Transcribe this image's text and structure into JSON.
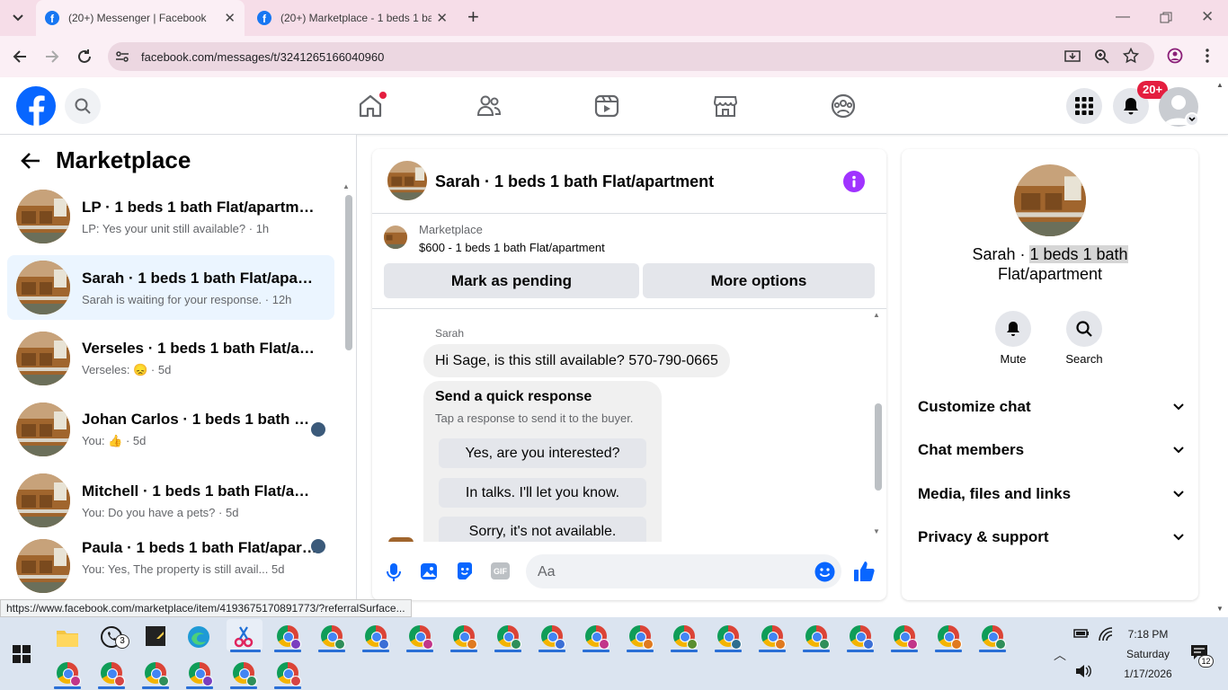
{
  "browser": {
    "tabs": [
      {
        "title": "(20+) Messenger | Facebook",
        "active": true
      },
      {
        "title": "(20+) Marketplace - 1 beds 1 ba",
        "active": false
      }
    ],
    "new_tab_symbol": "+",
    "url": "facebook.com/messages/t/3241265166040960"
  },
  "fb_header": {
    "notification_badge": "20+",
    "nav_icons": [
      "home-icon",
      "friends-icon",
      "watch-icon",
      "marketplace-icon",
      "groups-icon"
    ]
  },
  "left_panel": {
    "title": "Marketplace",
    "conversations": [
      {
        "name": "LP · 1 beds 1 bath Flat/apartment",
        "snippet": "LP: Yes your unit still available?",
        "time": "· 1h",
        "selected": false,
        "emoji": "",
        "avatar": false
      },
      {
        "name": "Sarah · 1 beds 1 bath Flat/apartment",
        "snippet": "Sarah is waiting for your response.",
        "time": "· 12h",
        "selected": true,
        "emoji": "",
        "avatar": false
      },
      {
        "name": "Verseles · 1 beds 1 bath Flat/apartment",
        "snippet": "Verseles: ",
        "time": "· 5d",
        "selected": false,
        "emoji": "😞",
        "avatar": false
      },
      {
        "name": "Johan Carlos · 1 beds 1 bath Flat/apartment",
        "snippet": "You: ",
        "time": "· 5d",
        "selected": false,
        "emoji": "👍",
        "avatar": true
      },
      {
        "name": "Mitchell · 1 beds 1 bath Flat/apartment",
        "snippet": "You: Do you have a pets?",
        "time": "· 5d",
        "selected": false,
        "emoji": "",
        "avatar": false
      },
      {
        "name": "Paula · 1 beds 1 bath Flat/apartment",
        "snippet": "You: Yes, The property is still avail...",
        "time": "5d",
        "selected": false,
        "emoji": "",
        "avatar": true
      }
    ]
  },
  "chat": {
    "title": "Sarah · 1 beds 1 bath Flat/apartment",
    "listing_label": "Marketplace",
    "listing_price_title": "$600 - 1 beds 1 bath Flat/apartment",
    "mark_pending": "Mark as pending",
    "more_options": "More options",
    "sender": "Sarah",
    "message": "Hi Sage, is this still available? 570-790-0665",
    "quick_title": "Send a quick response",
    "quick_sub": "Tap a response to send it to the buyer.",
    "quick_replies": [
      "Yes, are you interested?",
      "In talks. I'll let you know.",
      "Sorry, it's not available."
    ],
    "input_placeholder": "Aa",
    "gif_label": "GIF"
  },
  "info_panel": {
    "name_prefix": "Sarah · ",
    "name_highlight": "1 beds 1 bath",
    "name_line2": "Flat/apartment",
    "mute_label": "Mute",
    "search_label": "Search",
    "sections": [
      "Customize chat",
      "Chat members",
      "Media, files and links",
      "Privacy & support"
    ]
  },
  "status_url": "https://www.facebook.com/marketplace/item/4193675170891773/?referralSurface...",
  "taskbar": {
    "whatsapp_badge": "3",
    "time": "7:18 PM",
    "day": "Saturday",
    "date": "1/17/2026",
    "notif_count": "12"
  },
  "colors": {
    "fb_blue": "#1877f2",
    "messenger_purple": "#a033ff",
    "selected_bg": "#ebf5ff"
  }
}
